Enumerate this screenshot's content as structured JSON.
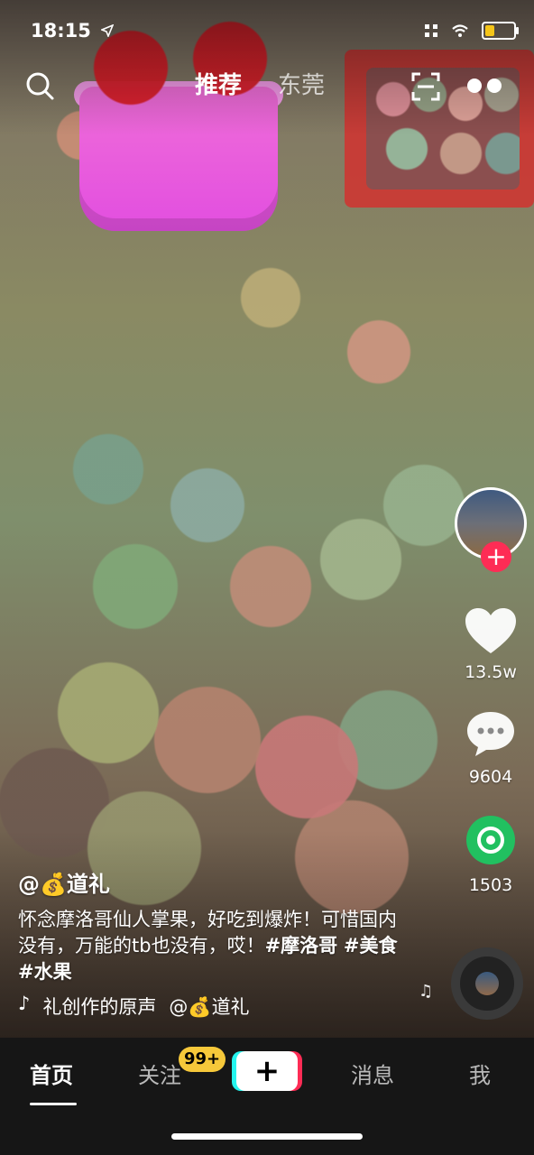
{
  "status_bar": {
    "time": "18:15",
    "location_arrow": "location-arrow-icon",
    "icons": [
      "grid-icon",
      "wifi-icon",
      "battery-icon"
    ],
    "battery_color": "#f5c518"
  },
  "top_nav": {
    "tabs": [
      {
        "label": "推荐",
        "active": true
      },
      {
        "label": "东莞",
        "active": false
      }
    ]
  },
  "right_rail": {
    "likes": "13.5w",
    "comments": "9604",
    "shares": "1503"
  },
  "caption": {
    "author_prefix": "@",
    "author_emoji": "💰",
    "author_name": "道礼",
    "desc_text": "怀念摩洛哥仙人掌果，好吃到爆炸！可惜国内没有，万能的tb也没有，哎！",
    "hashtags": [
      "#摩洛哥",
      "#美食",
      "#水果"
    ]
  },
  "music": {
    "title": "礼创作的原声",
    "author": "道礼",
    "author_prefix": "@",
    "author_emoji": "💰"
  },
  "bottom_nav": {
    "items": [
      {
        "label": "首页",
        "active": true
      },
      {
        "label": "关注",
        "active": false
      },
      {
        "label": "+",
        "active": false
      },
      {
        "label": "消息",
        "active": false
      },
      {
        "label": "我",
        "active": false
      }
    ],
    "badge": "99+"
  },
  "colors": {
    "accent_red": "#fe2c55",
    "accent_cyan": "#25f4ee",
    "share_green": "#21c060",
    "badge_yellow": "#f6c83a"
  }
}
